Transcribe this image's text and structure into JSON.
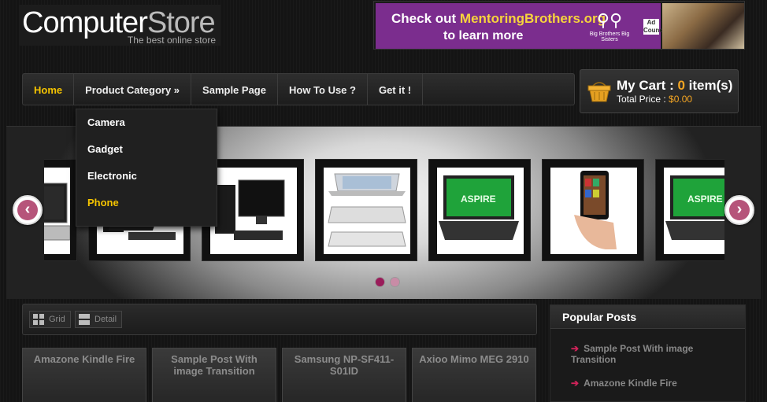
{
  "logo": {
    "word1": "Computer",
    "word2": "Store",
    "tagline": "The best online store"
  },
  "ad": {
    "line1_prefix": "Check out ",
    "line1_site": "MentoringBrothers.org",
    "line2": "to learn more",
    "org": "Big Brothers Big Sisters",
    "badge": "Ad Council"
  },
  "nav": {
    "items": [
      {
        "label": "Home",
        "active": true
      },
      {
        "label": "Product Category »",
        "active": false
      },
      {
        "label": "Sample Page",
        "active": false
      },
      {
        "label": "How To Use ?",
        "active": false
      },
      {
        "label": "Get it !",
        "active": false
      }
    ],
    "dropdown": [
      "Camera",
      "Gadget",
      "Electronic",
      "Phone"
    ],
    "dropdown_active": "Phone"
  },
  "cart": {
    "title_prefix": "My Cart : ",
    "count": "0",
    "title_suffix": " item(s)",
    "total_label": "Total Price : ",
    "total_value": "$0.00"
  },
  "slider": {
    "slides": [
      "laptop",
      "desktop-pc",
      "desktop-pc-2",
      "macbook-air",
      "acer-aspire",
      "kindle-fire",
      "acer-aspire-2"
    ],
    "dots": 2,
    "active_dot": 0,
    "colors": {
      "arrow": "#b6547a",
      "dot_active": "#9a1c5a"
    }
  },
  "toolbar": {
    "grid_label": "Grid",
    "detail_label": "Detail"
  },
  "posts": [
    "Amazone Kindle Fire",
    "Sample Post With image Transition",
    "Samsung NP-SF411-S01ID",
    "Axioo Mimo MEG 2910"
  ],
  "popular": {
    "title": "Popular Posts",
    "items": [
      "Sample Post With image Transition",
      "Amazone Kindle Fire"
    ]
  }
}
